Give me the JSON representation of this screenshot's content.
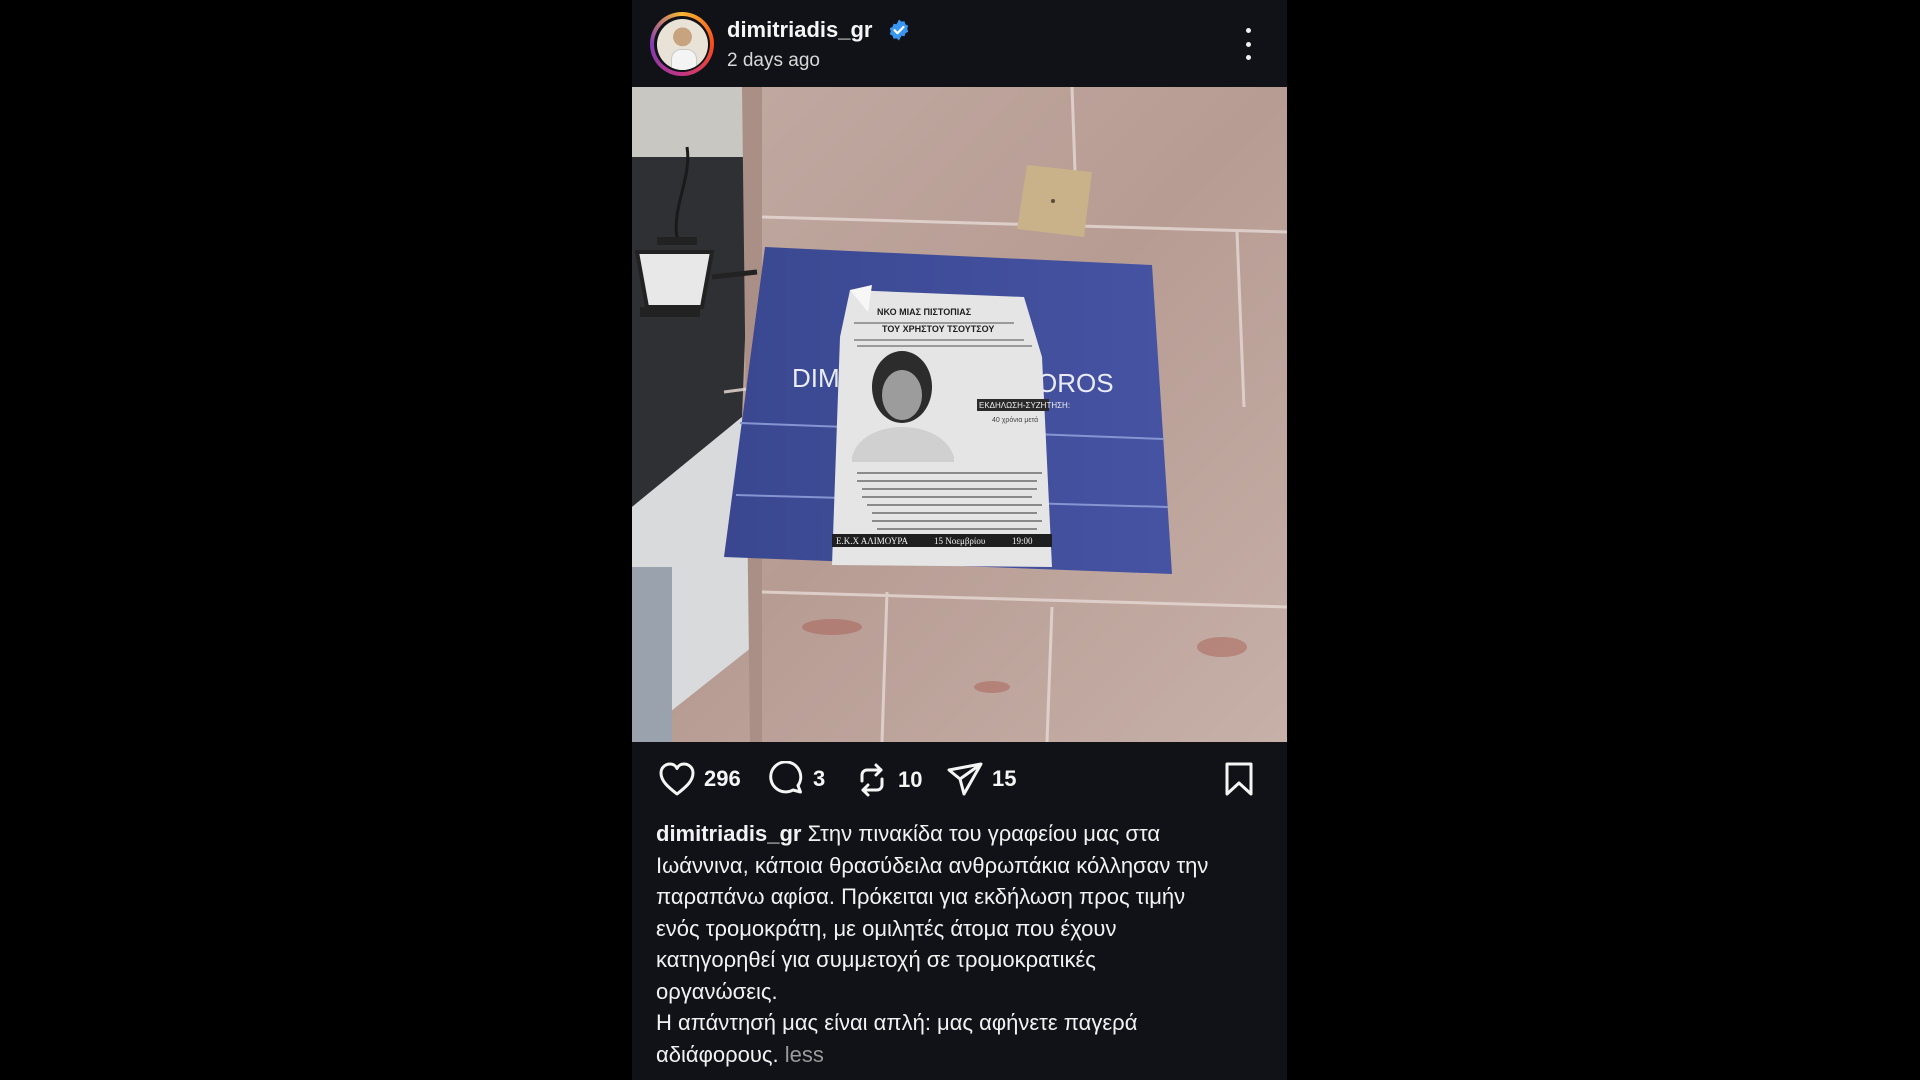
{
  "post": {
    "username": "dimitriadis_gr",
    "timestamp": "2 days ago",
    "verified": true
  },
  "image": {
    "plaque_text_left": "DIM",
    "plaque_text_right": "OROS",
    "poster": {
      "headline_1": "ΝΚΟ ΜΙΑΣ ΠΙΣΤΟΠΙΑΣ",
      "headline_2": "ΤΟΥ ΧΡΗΣΤΟΥ ΤΣΟΥΤΣΟΥ",
      "event_label": "ΕΚΔΗΛΩΣΗ-ΣΥΖΗΤΗΣΗ:",
      "event_sub": "40 χρόνια μετά",
      "footer_left": "Ε.Κ.Χ ΑΛΙΜΟΥΡΑ",
      "footer_mid": "15 Νοεμβρίου",
      "footer_right": "19:00"
    }
  },
  "actions": {
    "likes": "296",
    "comments": "3",
    "reposts": "10",
    "shares": "15"
  },
  "caption": {
    "username": "dimitriadis_gr",
    "lines": [
      "Στην πινακίδα του γραφείου μας στα",
      "Ιωάννινα, κάποια θρασύδειλα ανθρωπάκια κόλλησαν την",
      "παραπάνω αφίσα. Πρόκειται για εκδήλωση προς τιμήν",
      "ενός τρομοκράτη, με ομιλητές άτομα που έχουν",
      "κατηγορηθεί για συμμετοχή σε τρομοκρατικές",
      "οργανώσεις.",
      "Η απάντησή μας είναι απλή: μας αφήνετε παγερά",
      "αδιάφορους."
    ],
    "less_label": "less"
  },
  "colors": {
    "background": "#101217",
    "verified": "#3897f0",
    "plaque": "#3f4d9a"
  },
  "icons": [
    "verified-badge-icon",
    "more-options-icon",
    "heart-icon",
    "comment-icon",
    "repost-icon",
    "share-icon",
    "bookmark-icon"
  ]
}
